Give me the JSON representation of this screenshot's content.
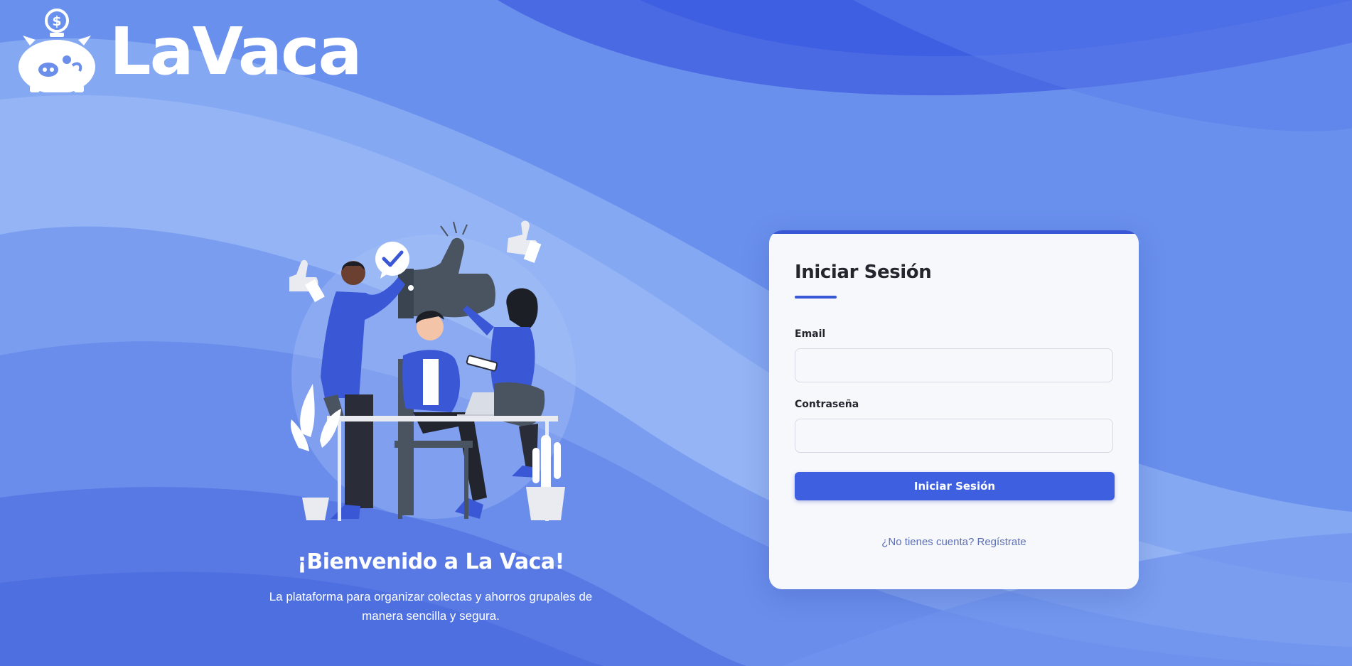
{
  "brand": {
    "name": "LaVaca",
    "logo_icon": "piggy-bank-dollar-icon"
  },
  "welcome": {
    "title": "¡Bienvenido a La Vaca!",
    "subtitle": "La plataforma para organizar colectas y ahorros grupales de manera sencilla y segura."
  },
  "login": {
    "title": "Iniciar Sesión",
    "email_label": "Email",
    "email_value": "",
    "password_label": "Contraseña",
    "password_value": "",
    "submit_label": "Iniciar Sesión",
    "signup_text": "¿No tienes cuenta? Regístrate"
  },
  "colors": {
    "primary": "#3e5fe0",
    "background": "#5f84ea",
    "card": "#f7f8fc",
    "link": "#5c6fb5"
  }
}
